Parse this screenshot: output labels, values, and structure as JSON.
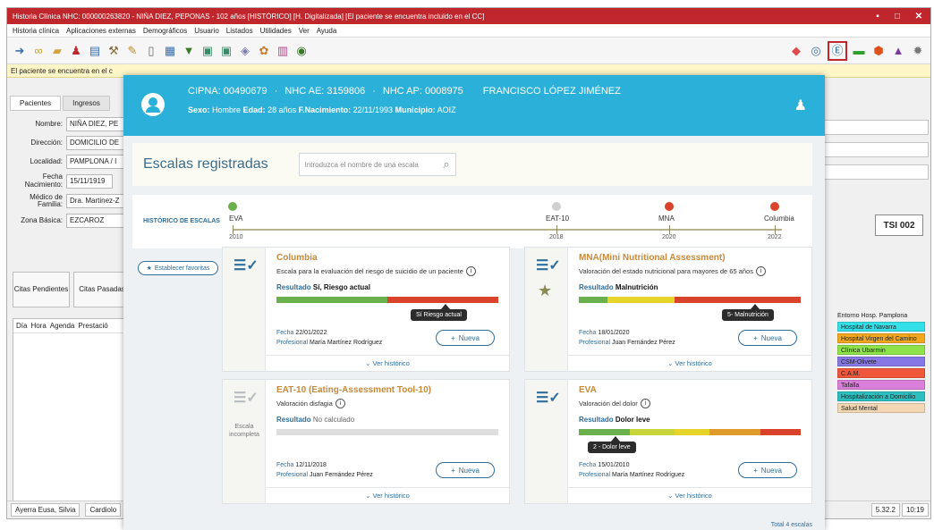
{
  "window": {
    "title": "Historia Clínica  NHC: 000000263820 - NIÑA DIEZ, PEPONAS - 102 años [HISTÓRICO] [H. Digitalizada] [El paciente se encuentra incluido en el CC]",
    "controls": {
      "min": "▪",
      "max": "□",
      "close": "✕"
    }
  },
  "menu": [
    "Historia clínica",
    "Aplicaciones externas",
    "Demográficos",
    "Usuario",
    "Listados",
    "Utilidades",
    "Ver",
    "Ayuda"
  ],
  "infobar": {
    "text": "El paciente se encuentra en el c"
  },
  "tabs": [
    "Pacientes",
    "Ingresos"
  ],
  "form": {
    "nombre": {
      "label": "Nombre:",
      "value": "NIÑA DIEZ, PE"
    },
    "direccion": {
      "label": "Dirección:",
      "value": "DOMICILIO DE"
    },
    "localidad": {
      "label": "Localidad:",
      "value": "PAMPLONA / I"
    },
    "fecha_nac": {
      "label": "Fecha Nacimiento:",
      "value": "15/11/1919"
    },
    "medico": {
      "label": "Médico de Familia:",
      "value": "Dra. Martinez-Z"
    },
    "zona": {
      "label": "Zona Básica:",
      "value": "EZCAROZ"
    }
  },
  "left_buttons": {
    "pendientes": "Citas Pendientes",
    "pasadas": "Citas Pasadas"
  },
  "grid_headers": [
    "Día",
    "Hora",
    "Agenda",
    "Prestació"
  ],
  "status": {
    "user": "Ayerra Eusa, Silvia",
    "dept": "Cardiolo",
    "version": "5.32.2",
    "time": "10:19"
  },
  "tsi": "TSI 002",
  "legend": {
    "title": "Entorno Hosp. Pamplona",
    "items": [
      {
        "label": "Hospital de Navarra",
        "color": "#33e0e8"
      },
      {
        "label": "Hospital Virgen del Camino",
        "color": "#f2a71c"
      },
      {
        "label": "Clínica Ubarmin",
        "color": "#8ee24a"
      },
      {
        "label": "CSM-Olivete",
        "color": "#8577e6"
      },
      {
        "label": "C.A.M.",
        "color": "#f0563a"
      },
      {
        "label": "Tafalla",
        "color": "#d97fd9"
      },
      {
        "label": "Hospitalización a Domicilio",
        "color": "#2dbfbf"
      },
      {
        "label": "Salud Mental",
        "color": "#f3d7b4"
      }
    ]
  },
  "patient": {
    "cipna": "CIPNA: 00490679",
    "nhc_ae": "NHC AE: 3159806",
    "nhc_ap": "NHC AP: 0008975",
    "name": "FRANCISCO LÓPEZ JIMÉNEZ",
    "sexo_label": "Sexo:",
    "sexo": "Hombre",
    "edad_label": "Edad:",
    "edad": "28 años",
    "fnac_label": "F.Nacimiento:",
    "fnac": "22/11/1993",
    "mun_label": "Municipio:",
    "mun": "AOIZ"
  },
  "scales": {
    "title": "Escalas registradas",
    "search_placeholder": "Introduzca el nombre de una escala",
    "history_label": "HISTÓRICO DE ESCALAS",
    "history": [
      {
        "name": "EVA",
        "year": "2010",
        "color": "#6ab04c"
      },
      {
        "name": "EAT-10",
        "year": "2018",
        "color": "#d0d0d0"
      },
      {
        "name": "MNA",
        "year": "2020",
        "color": "#d9432b"
      },
      {
        "name": "Columbia",
        "year": "2022",
        "color": "#d9432b"
      }
    ],
    "fav_label": "Establecer favoritas",
    "result_label": "Resultado",
    "date_label": "Fecha",
    "prof_label": "Profesional",
    "new_label": "Nueva",
    "history_link": "Ver histórico",
    "total": "Total 4 escalas",
    "incomplete": "Escala incompleta",
    "cards": {
      "columbia": {
        "title": "Columbia",
        "desc": "Escala para la evaluación del riesgo de suicidio de un paciente",
        "result": "Sí, Riesgo actual",
        "tooltip": "Sí Riesgo actual",
        "date": "22/01/2022",
        "prof": "María Martínez Rodríguez"
      },
      "mna": {
        "title": "MNA(Mini Nutritional Assessment)",
        "desc": "Valoración del estado nutricional para mayores de 65 años",
        "result": "Malnutrición",
        "tooltip": "5- Malnutrición",
        "date": "18/01/2020",
        "prof": "Juan Fernández Pérez"
      },
      "eat10": {
        "title": "EAT-10 (Eating-Assessment Tool-10)",
        "desc": "Valoración disfagia",
        "result": "No calculado",
        "date": "12/11/2018",
        "prof": "Juan Fernández Pérez"
      },
      "eva": {
        "title": "EVA",
        "desc": "Valoración del dolor",
        "result": "Dolor leve",
        "tooltip": "2 - Dolor leve",
        "date": "15/01/2010",
        "prof": "María Martínez Rodríguez"
      }
    }
  },
  "colors": {
    "brand_red": "#c0272d",
    "header_blue": "#2bb0d9",
    "accent_blue": "#2f6d9a",
    "title_orange": "#c7893a"
  }
}
